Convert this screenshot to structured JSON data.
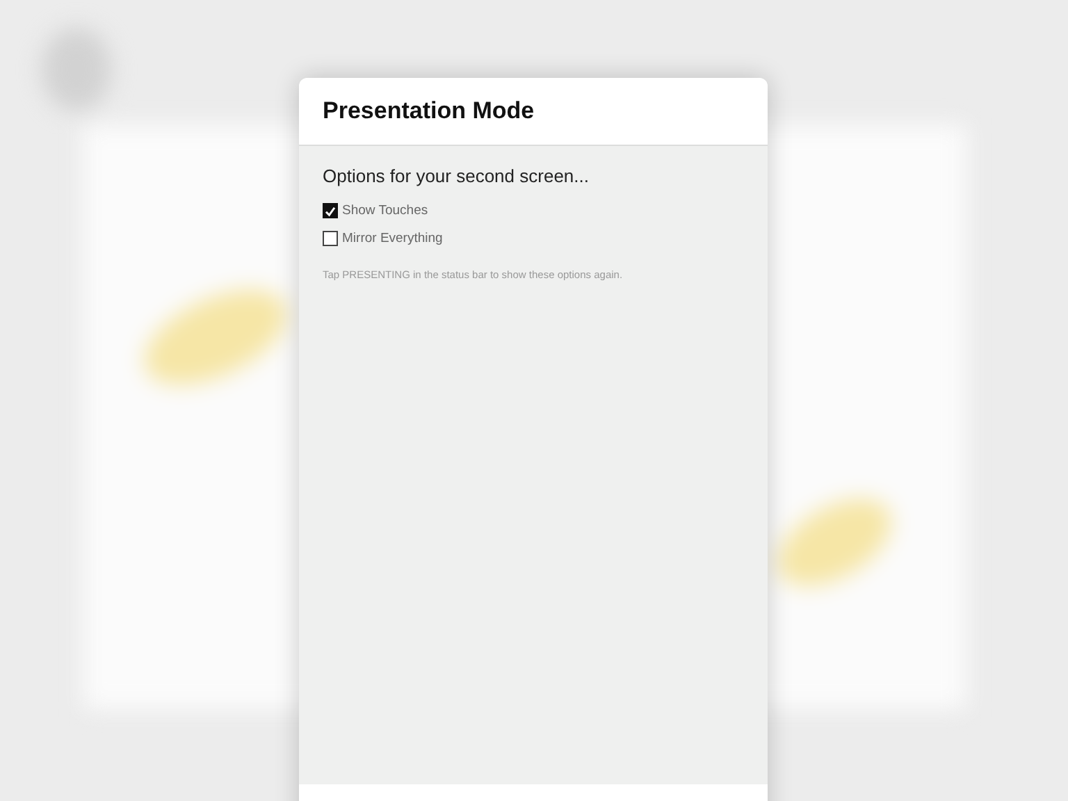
{
  "dialog": {
    "title": "Presentation Mode",
    "heading": "Options for your second screen...",
    "options": [
      {
        "label": "Show Touches",
        "checked": true
      },
      {
        "label": "Mirror Everything",
        "checked": false
      }
    ],
    "hint": "Tap PRESENTING in the status bar to show these options again."
  }
}
